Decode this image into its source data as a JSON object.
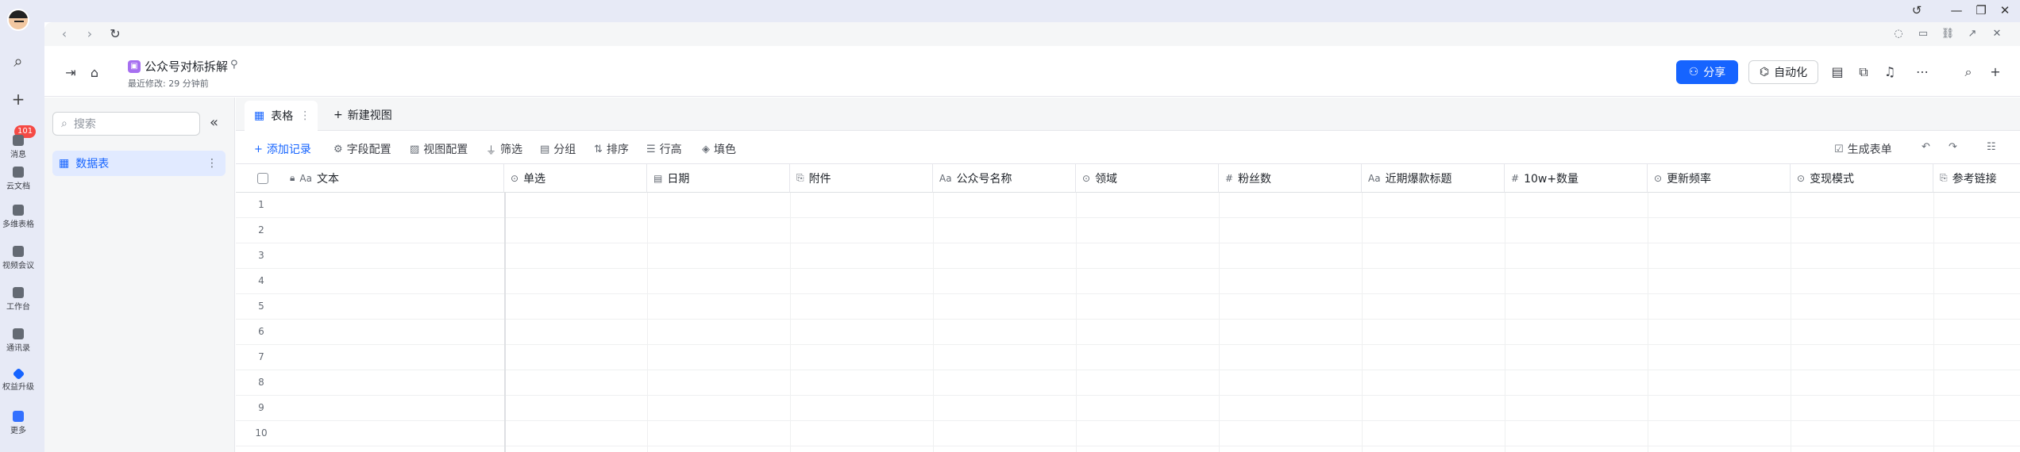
{
  "rail": {
    "badge_count": "101",
    "items": [
      {
        "label": "消息"
      },
      {
        "label": "云文档"
      },
      {
        "label": "多维表格"
      },
      {
        "label": "视频会议"
      },
      {
        "label": "工作台"
      },
      {
        "label": "通讯录"
      },
      {
        "label": "权益升级"
      },
      {
        "label": "更多"
      }
    ]
  },
  "doc": {
    "title": "公众号对标拆解",
    "subtitle": "最近修改: 29 分钟前",
    "share_label": "分享",
    "automation_label": "自动化"
  },
  "sidebar": {
    "search_placeholder": "搜索",
    "table_label": "数据表"
  },
  "views": {
    "active_tab": "表格",
    "new_view": "新建视图"
  },
  "toolbar": {
    "add_record": "添加记录",
    "field_config": "字段配置",
    "view_config": "视图配置",
    "filter": "筛选",
    "group": "分组",
    "sort": "排序",
    "row_height": "行高",
    "fill_color": "填色",
    "gen_form": "生成表单"
  },
  "columns": [
    {
      "label": "文本",
      "icon": "Aa"
    },
    {
      "label": "单选",
      "icon": "⊙"
    },
    {
      "label": "日期",
      "icon": "▤"
    },
    {
      "label": "附件",
      "icon": "⎘"
    },
    {
      "label": "公众号名称",
      "icon": "Aa"
    },
    {
      "label": "领域",
      "icon": "⊙"
    },
    {
      "label": "粉丝数",
      "icon": "#"
    },
    {
      "label": "近期爆款标题",
      "icon": "Aa"
    },
    {
      "label": "10w+数量",
      "icon": "#"
    },
    {
      "label": "更新频率",
      "icon": "⊙"
    },
    {
      "label": "变现模式",
      "icon": "⊙"
    },
    {
      "label": "参考链接",
      "icon": "⎘"
    }
  ],
  "rows": [
    "1",
    "2",
    "3",
    "4",
    "5",
    "6",
    "7",
    "8",
    "9",
    "10"
  ],
  "colors": {
    "accent": "#1664ff",
    "doc_icon": "#a66ff0",
    "badge": "#f54a45"
  }
}
